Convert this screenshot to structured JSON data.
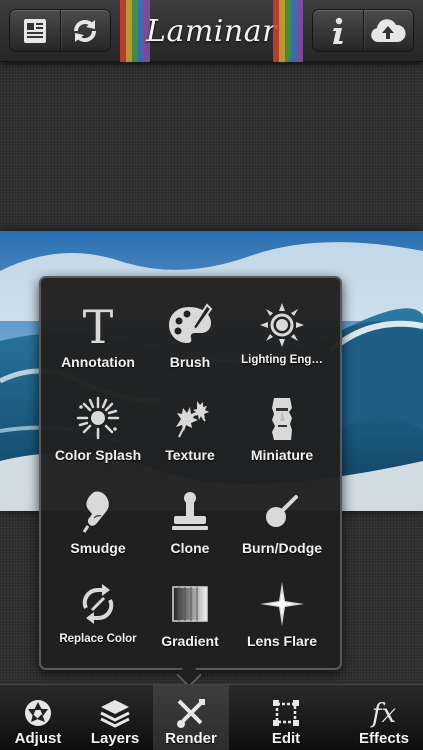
{
  "header": {
    "logo_text": "Laminar",
    "left_buttons": [
      "document-icon",
      "refresh-icon"
    ],
    "right_buttons": [
      "info-icon",
      "cloud-upload-icon"
    ],
    "stripe_colors": [
      "#c7423a",
      "#e0a32e",
      "#4e9a3e",
      "#3a78c4",
      "#8a4fb0"
    ]
  },
  "tools": [
    {
      "label": "Annotation",
      "icon": "text-t-icon"
    },
    {
      "label": "Brush",
      "icon": "palette-icon"
    },
    {
      "label": "Lighting Eng…",
      "icon": "sun-icon"
    },
    {
      "label": "Color Splash",
      "icon": "splash-icon"
    },
    {
      "label": "Texture",
      "icon": "leaves-icon"
    },
    {
      "label": "Miniature",
      "icon": "moai-icon"
    },
    {
      "label": "Smudge",
      "icon": "finger-icon"
    },
    {
      "label": "Clone",
      "icon": "stamp-icon"
    },
    {
      "label": "Burn/Dodge",
      "icon": "dodge-tool-icon"
    },
    {
      "label": "Replace Color",
      "icon": "replace-arrows-icon"
    },
    {
      "label": "Gradient",
      "icon": "gradient-icon"
    },
    {
      "label": "Lens Flare",
      "icon": "star-flare-icon"
    }
  ],
  "tabs": [
    {
      "label": "Adjust",
      "icon": "aperture-icon",
      "active": false
    },
    {
      "label": "Layers",
      "icon": "layers-icon",
      "active": false
    },
    {
      "label": "Render",
      "icon": "render-tools-icon",
      "active": true
    },
    {
      "label": "Edit",
      "icon": "crop-frame-icon",
      "active": false
    },
    {
      "label": "Effects",
      "icon": "fx-icon",
      "active": false
    }
  ],
  "colors": {
    "panel_bg": "#202020",
    "panel_border": "#5a5a5a",
    "icon_fill": "#d9d9d9",
    "sky_top": "#2a6fb1",
    "wave": "#1f5f86"
  }
}
